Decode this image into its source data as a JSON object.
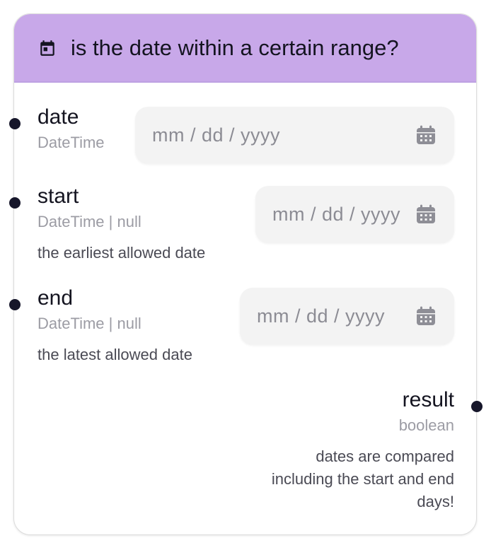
{
  "node": {
    "title": "is the date within a certain range?",
    "header_icon": "calendar-event-icon",
    "accent": "#c8a8e9"
  },
  "inputs": [
    {
      "label": "date",
      "type": "DateTime",
      "description": "",
      "placeholder": "mm / dd / yyyy"
    },
    {
      "label": "start",
      "type": "DateTime | null",
      "description": "the earliest allowed date",
      "placeholder": "mm / dd / yyyy"
    },
    {
      "label": "end",
      "type": "DateTime | null",
      "description": "the latest allowed date",
      "placeholder": "mm / dd / yyyy"
    }
  ],
  "output": {
    "label": "result",
    "type": "boolean",
    "description": "dates are compared including the start and end days!"
  },
  "icons": {
    "date_picker": "calendar-icon"
  }
}
